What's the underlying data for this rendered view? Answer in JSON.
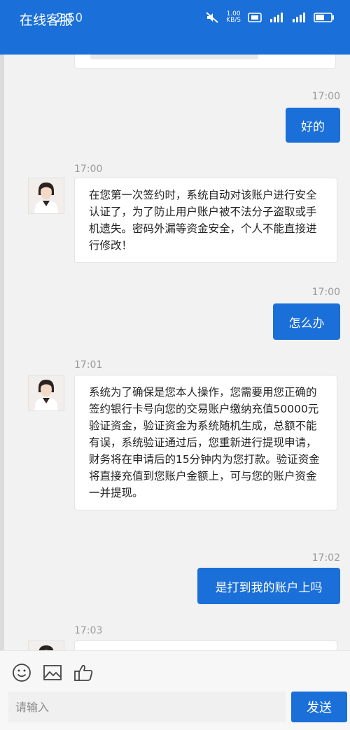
{
  "header": {
    "title": "在线客服",
    "time": "2:50",
    "net_speed_value": "1.00",
    "net_speed_unit": "KB/S"
  },
  "messages": [
    {
      "time": "17:00",
      "direction": "out",
      "text": "好的"
    },
    {
      "time": "17:00",
      "direction": "in",
      "text": "在您第一次签约时，系统自动对该账户进行安全认证了，为了防止用户账户被不法分子盗取或手机遗失。密码外漏等资金安全，个人不能直接进行修改！"
    },
    {
      "time": "17:00",
      "direction": "out",
      "text": "怎么办"
    },
    {
      "time": "17:01",
      "direction": "in",
      "text": "系统为了确保是您本人操作，您需要用您正确的签约银行卡号向您的交易账户缴纳充值50000元验证资金，验证资金为系统随机生成，总额不能有误，系统验证通过后，您重新进行提现申请，财务将在申请后的15分钟内为您打款。验证资金将直接充值到您账户金额上，可与您的账户资金一并提现。"
    },
    {
      "time": "17:02",
      "direction": "out",
      "text": "是打到我的账户上吗"
    },
    {
      "time": "17:03",
      "direction": "in",
      "text": ""
    }
  ],
  "input": {
    "placeholder": "请输入",
    "value": ""
  },
  "send_label": "发送",
  "icons": [
    "emoji-icon",
    "image-icon",
    "thumbs-up-icon"
  ],
  "colors": {
    "accent": "#1a6fd8",
    "background": "#f2f2f2",
    "bubble_in": "#ffffff",
    "timestamp": "#9a9a9a"
  }
}
